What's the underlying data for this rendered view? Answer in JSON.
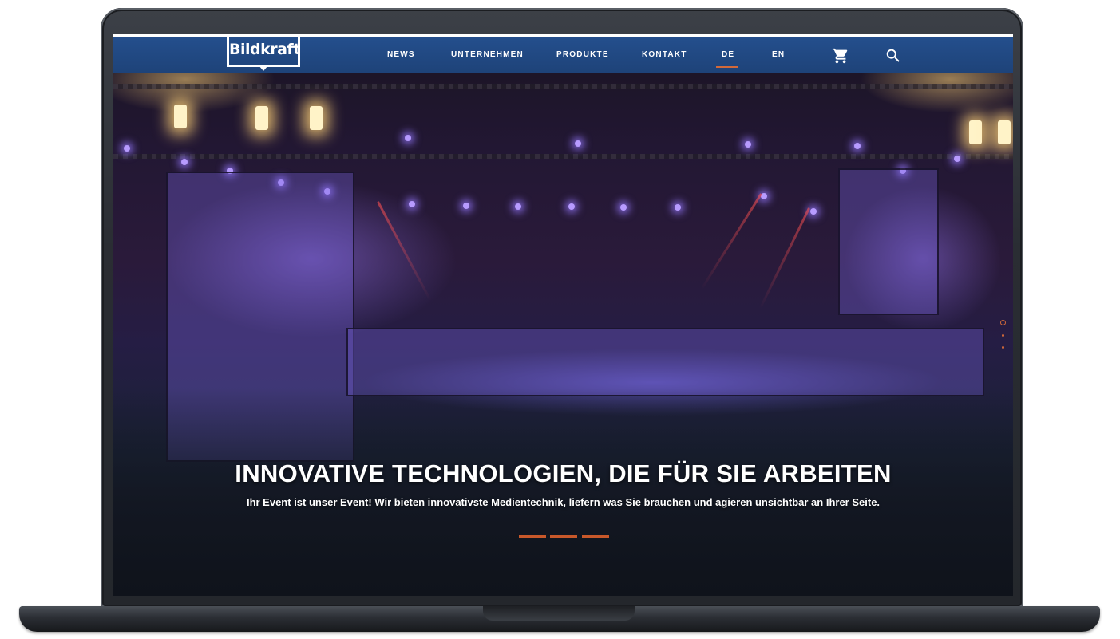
{
  "nav": {
    "logo_text": "Bildkraft",
    "items": [
      {
        "label": "NEWS"
      },
      {
        "label": "UNTERNEHMEN"
      },
      {
        "label": "PRODUKTE"
      },
      {
        "label": "KONTAKT"
      },
      {
        "label": "DE"
      },
      {
        "label": "EN"
      }
    ],
    "active_language": "DE",
    "icons": [
      "cart-icon",
      "search-icon"
    ]
  },
  "hero": {
    "title": "INNOVATIVE TECHNOLOGIEN, DIE FÜR SIE ARBEITEN",
    "subtitle": "Ihr Event ist unser Event! Wir bieten innovativste Medientechnik, liefern was Sie brauchen und agieren unsichtbar an Ihrer Seite.",
    "slides_count": 3,
    "side_dots_count": 3,
    "active_side_dot": 0
  },
  "colors": {
    "nav_bg": "#244f8d",
    "accent": "#d2693a",
    "text": "#ffffff"
  }
}
